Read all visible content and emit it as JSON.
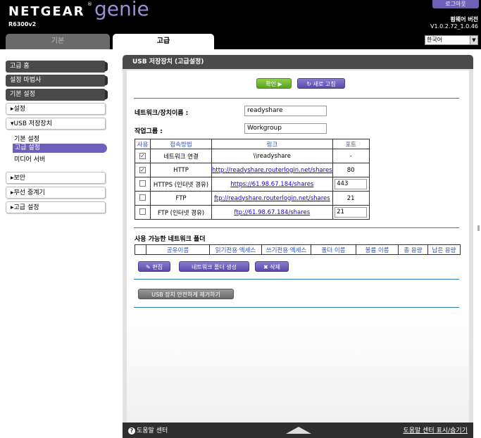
{
  "header": {
    "brand": "NETGEAR",
    "product": "genie",
    "model": "R6300v2",
    "logout_label": "로그아웃",
    "firmware_label": "펌웨어 버전",
    "firmware_version": "V1.0.2.72_1.0.46",
    "language": "한국어",
    "tabs": [
      {
        "label": "기본",
        "active": false
      },
      {
        "label": "고급",
        "active": true
      }
    ]
  },
  "sidebar": {
    "items": [
      {
        "label": "고급 홈"
      },
      {
        "label": "설정 마법사"
      },
      {
        "label": "기본 설정"
      },
      {
        "label": "▸설정"
      },
      {
        "label": "▾USB 저장장치"
      },
      {
        "label": "기본 설정"
      },
      {
        "label": "고급 설정"
      },
      {
        "label": "미디어 서버"
      },
      {
        "label": "▸보안"
      },
      {
        "label": "▸무선 중계기"
      },
      {
        "label": "▸고급 설정"
      }
    ]
  },
  "panel": {
    "title": "USB 저장장치 (고급설정)",
    "apply_label": "확인 ▶",
    "refresh_label": "새로 고침",
    "network_device_label": "네트워크/장치이름 :",
    "network_device_value": "readyshare",
    "workgroup_label": "작업그룹 :",
    "workgroup_value": "Workgroup",
    "access_table": {
      "headers": [
        "사용",
        "접속방법",
        "링크",
        "포트"
      ],
      "rows": [
        {
          "checked": true,
          "method": "네트워크 연결",
          "link": "\\\\readyshare",
          "port": "-"
        },
        {
          "checked": true,
          "method": "HTTP",
          "link": "http://readyshare.routerlogin.net/shares",
          "port": "80"
        },
        {
          "checked": false,
          "method": "HTTPS (인터넷 경유)",
          "link": "https://61.98.67.184/shares",
          "port": "443"
        },
        {
          "checked": false,
          "method": "FTP",
          "link": "ftp://readyshare.routerlogin.net/shares",
          "port": "21"
        },
        {
          "checked": false,
          "method": "FTP (인터넷 경유)",
          "link": "ftp://61.98.67.184/shares",
          "port": "21"
        }
      ]
    },
    "folders_title": "사용 가능한 네트워크 폴더",
    "folders_headers": [
      "",
      "공유이름",
      "읽기전용 액세스",
      "쓰기전용 액세스",
      "폴더 이름",
      "볼륨 이름",
      "총 용량",
      "남은 용량"
    ],
    "edit_label": "✎ 편집",
    "create_label": "네트워크 폴더 생성",
    "delete_label": "✖ 삭제",
    "safe_remove_label": "USB 장치 안전하게 제거하기"
  },
  "footer": {
    "help_center": "도움말 센터",
    "toggle_help": "도움말 센터 표시/숨기기"
  },
  "colors": {
    "accent_purple": "#6e5fb8",
    "apply_green": "#5aa021",
    "divider_blue": "#2a7ab8",
    "header_black": "#000000"
  }
}
